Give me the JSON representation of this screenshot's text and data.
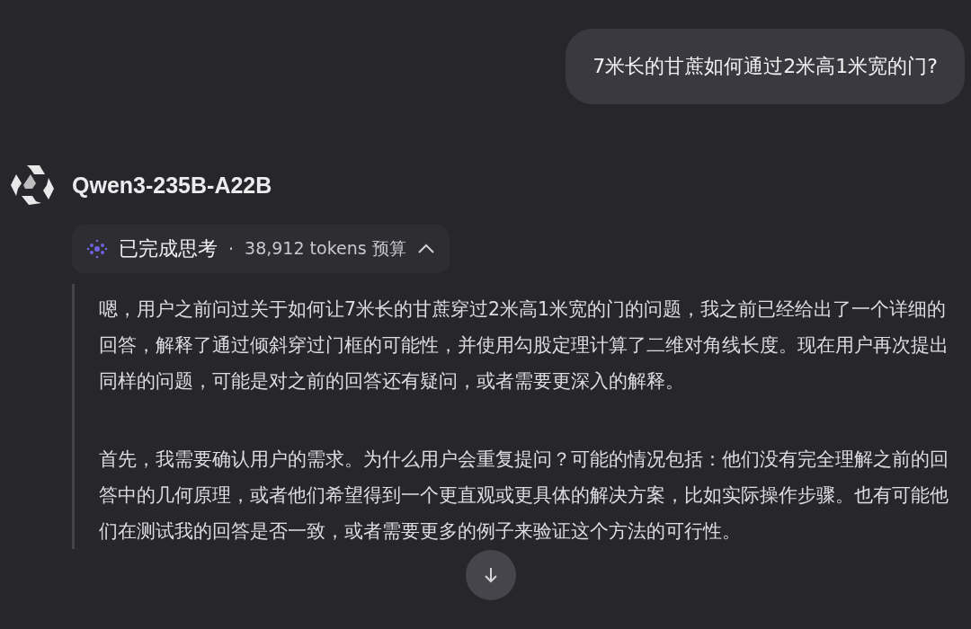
{
  "user_message": {
    "text": "7米长的甘蔗如何通过2米高1米宽的门?"
  },
  "reply": {
    "model": "Qwen3-235B-A22B",
    "thinking": {
      "status": "已完成思考",
      "separator": "·",
      "budget": "38,912 tokens 预算",
      "expanded": true,
      "paragraphs": [
        "嗯，用户之前问过关于如何让7米长的甘蔗穿过2米高1米宽的门的问题，我之前已经给出了一个详细的回答，解释了通过倾斜穿过门框的可能性，并使用勾股定理计算了二维对角线长度。现在用户再次提出同样的问题，可能是对之前的回答还有疑问，或者需要更深入的解释。",
        "首先，我需要确认用户的需求。为什么用户会重复提问？可能的情况包括：他们没有完全理解之前的回答中的几何原理，或者他们希望得到一个更直观或更具体的解决方案，比如实际操作步骤。也有可能他们在测试我的回答是否一致，或者需要更多的例子来验证这个方法的可行性。"
      ]
    }
  }
}
